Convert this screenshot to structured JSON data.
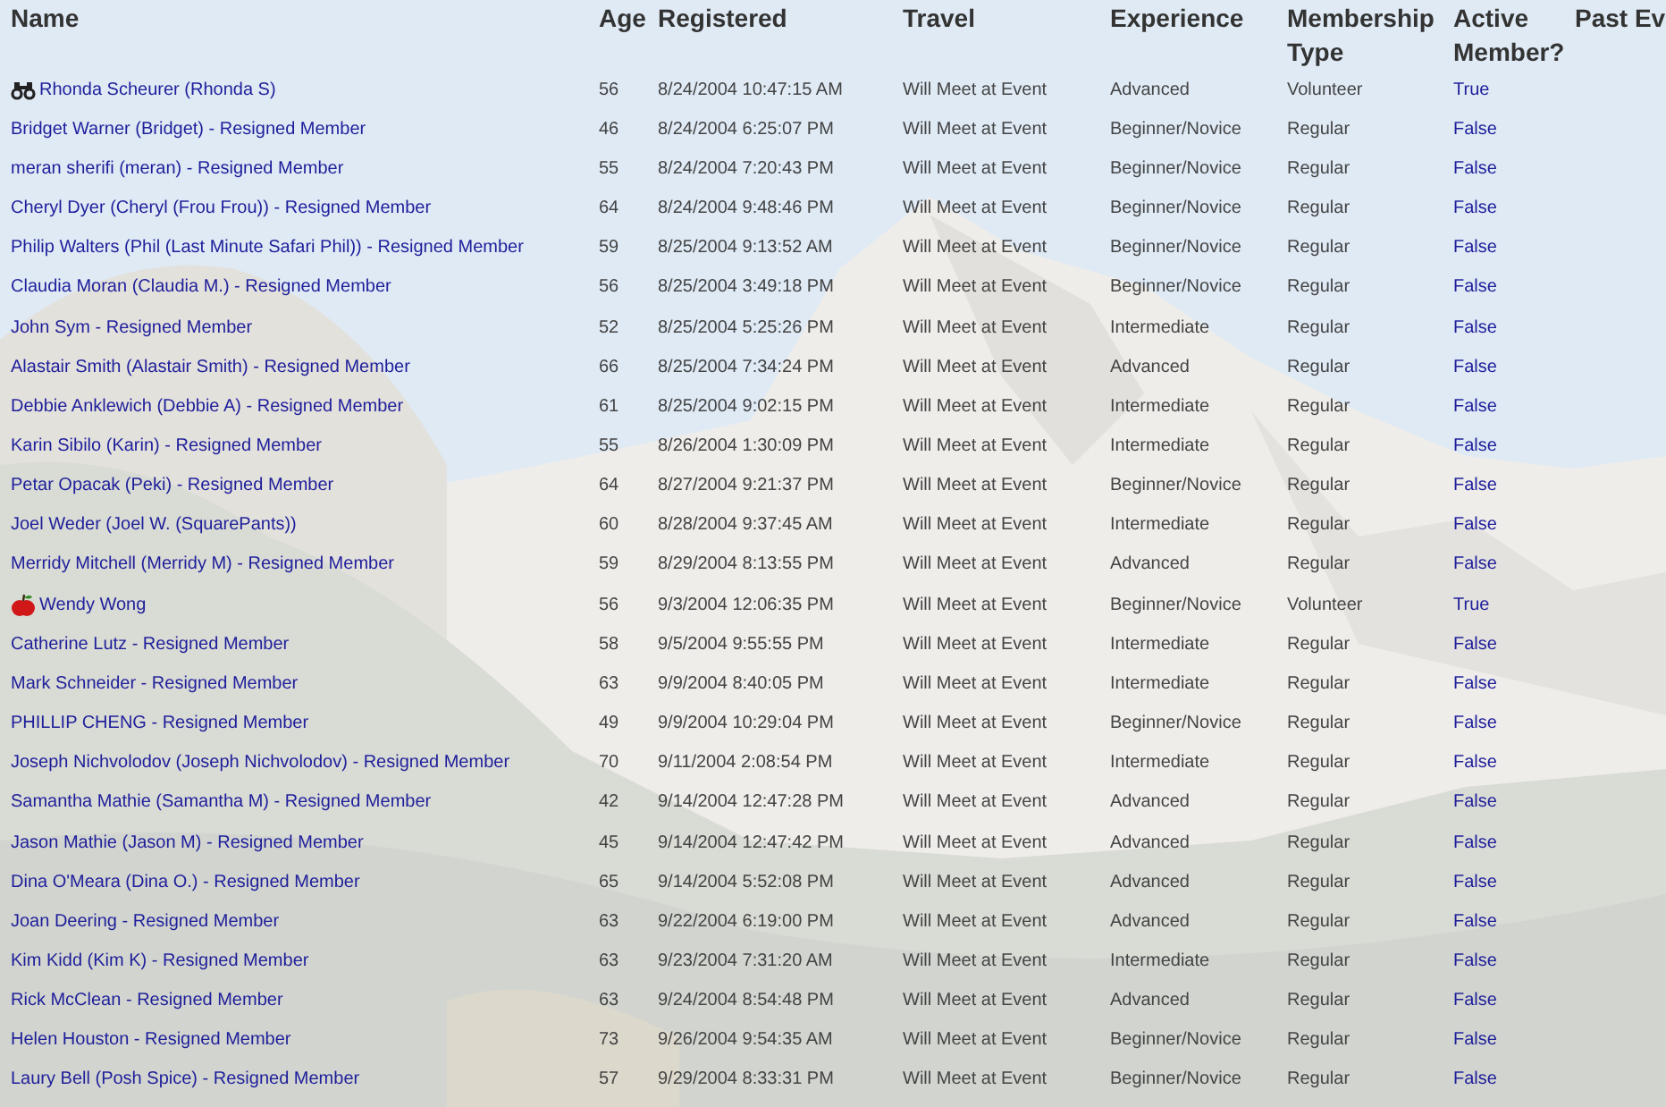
{
  "table": {
    "columns": [
      "Name",
      "Age",
      "Registered",
      "Travel",
      "Experience",
      "Membership Type",
      "Active Member?",
      "Past Ev"
    ],
    "rows": [
      {
        "kind": "binoculars",
        "name": "Rhonda Scheurer (Rhonda S)",
        "age": "56",
        "registered": "8/24/2004 10:47:15 AM",
        "travel": "Will Meet at Event",
        "experience": "Advanced",
        "membership": "Volunteer",
        "active": "True"
      },
      {
        "name": "Bridget Warner (Bridget) - Resigned Member",
        "age": "46",
        "registered": "8/24/2004 6:25:07 PM",
        "travel": "Will Meet at Event",
        "experience": "Beginner/Novice",
        "membership": "Regular",
        "active": "False"
      },
      {
        "name": "meran sherifi (meran) - Resigned Member",
        "age": "55",
        "registered": "8/24/2004 7:20:43 PM",
        "travel": "Will Meet at Event",
        "experience": "Beginner/Novice",
        "membership": "Regular",
        "active": "False"
      },
      {
        "name": "Cheryl Dyer (Cheryl (Frou Frou)) - Resigned Member",
        "age": "64",
        "registered": "8/24/2004 9:48:46 PM",
        "travel": "Will Meet at Event",
        "experience": "Beginner/Novice",
        "membership": "Regular",
        "active": "False"
      },
      {
        "name": "Philip Walters (Phil (Last Minute Safari Phil)) - Resigned Member",
        "age": "59",
        "registered": "8/25/2004 9:13:52 AM",
        "travel": "Will Meet at Event",
        "experience": "Beginner/Novice",
        "membership": "Regular",
        "active": "False"
      },
      {
        "name": "Claudia Moran (Claudia M.) - Resigned Member",
        "age": "56",
        "registered": "8/25/2004 3:49:18 PM",
        "travel": "Will Meet at Event",
        "experience": "Beginner/Novice",
        "membership": "Regular",
        "active": "False"
      },
      {
        "name": "John Sym - Resigned Member",
        "age": "52",
        "registered": "8/25/2004 5:25:26 PM",
        "travel": "Will Meet at Event",
        "experience": "Intermediate",
        "membership": "Regular",
        "active": "False"
      },
      {
        "name": "Alastair Smith (Alastair Smith) - Resigned Member",
        "age": "66",
        "registered": "8/25/2004 7:34:24 PM",
        "travel": "Will Meet at Event",
        "experience": "Advanced",
        "membership": "Regular",
        "active": "False"
      },
      {
        "name": "Debbie Anklewich (Debbie A) - Resigned Member",
        "age": "61",
        "registered": "8/25/2004 9:02:15 PM",
        "travel": "Will Meet at Event",
        "experience": "Intermediate",
        "membership": "Regular",
        "active": "False"
      },
      {
        "name": "Karin Sibilo (Karin) - Resigned Member",
        "age": "55",
        "registered": "8/26/2004 1:30:09 PM",
        "travel": "Will Meet at Event",
        "experience": "Intermediate",
        "membership": "Regular",
        "active": "False"
      },
      {
        "name": "Petar Opacak (Peki) - Resigned Member",
        "age": "64",
        "registered": "8/27/2004 9:21:37 PM",
        "travel": "Will Meet at Event",
        "experience": "Beginner/Novice",
        "membership": "Regular",
        "active": "False"
      },
      {
        "name": "Joel Weder (Joel W. (SquarePants))",
        "age": "60",
        "registered": "8/28/2004 9:37:45 AM",
        "travel": "Will Meet at Event",
        "experience": "Intermediate",
        "membership": "Regular",
        "active": "False"
      },
      {
        "name": "Merridy Mitchell (Merridy M) - Resigned Member",
        "age": "59",
        "registered": "8/29/2004 8:13:55 PM",
        "travel": "Will Meet at Event",
        "experience": "Advanced",
        "membership": "Regular",
        "active": "False"
      },
      {
        "kind": "apple",
        "name": "Wendy Wong",
        "age": "56",
        "registered": "9/3/2004 12:06:35 PM",
        "travel": "Will Meet at Event",
        "experience": "Beginner/Novice",
        "membership": "Volunteer",
        "active": "True"
      },
      {
        "name": "Catherine Lutz - Resigned Member",
        "age": "58",
        "registered": "9/5/2004 9:55:55 PM",
        "travel": "Will Meet at Event",
        "experience": "Intermediate",
        "membership": "Regular",
        "active": "False"
      },
      {
        "name": "Mark Schneider - Resigned Member",
        "age": "63",
        "registered": "9/9/2004 8:40:05 PM",
        "travel": "Will Meet at Event",
        "experience": "Intermediate",
        "membership": "Regular",
        "active": "False"
      },
      {
        "name": "PHILLIP CHENG - Resigned Member",
        "age": "49",
        "registered": "9/9/2004 10:29:04 PM",
        "travel": "Will Meet at Event",
        "experience": "Beginner/Novice",
        "membership": "Regular",
        "active": "False"
      },
      {
        "name": "Joseph Nichvolodov (Joseph Nichvolodov) - Resigned Member",
        "age": "70",
        "registered": "9/11/2004 2:08:54 PM",
        "travel": "Will Meet at Event",
        "experience": "Intermediate",
        "membership": "Regular",
        "active": "False"
      },
      {
        "name": "Samantha Mathie (Samantha M) - Resigned Member",
        "age": "42",
        "registered": "9/14/2004 12:47:28 PM",
        "travel": "Will Meet at Event",
        "experience": "Advanced",
        "membership": "Regular",
        "active": "False"
      },
      {
        "name": "Jason Mathie (Jason M) - Resigned Member",
        "age": "45",
        "registered": "9/14/2004 12:47:42 PM",
        "travel": "Will Meet at Event",
        "experience": "Advanced",
        "membership": "Regular",
        "active": "False"
      },
      {
        "name": "Dina O'Meara (Dina O.) - Resigned Member",
        "age": "65",
        "registered": "9/14/2004 5:52:08 PM",
        "travel": "Will Meet at Event",
        "experience": "Advanced",
        "membership": "Regular",
        "active": "False"
      },
      {
        "name": "Joan Deering - Resigned Member",
        "age": "63",
        "registered": "9/22/2004 6:19:00 PM",
        "travel": "Will Meet at Event",
        "experience": "Advanced",
        "membership": "Regular",
        "active": "False"
      },
      {
        "name": "Kim Kidd (Kim K) - Resigned Member",
        "age": "63",
        "registered": "9/23/2004 7:31:20 AM",
        "travel": "Will Meet at Event",
        "experience": "Intermediate",
        "membership": "Regular",
        "active": "False"
      },
      {
        "name": "Rick McClean - Resigned Member",
        "age": "63",
        "registered": "9/24/2004 8:54:48 PM",
        "travel": "Will Meet at Event",
        "experience": "Advanced",
        "membership": "Regular",
        "active": "False"
      },
      {
        "name": "Helen Houston - Resigned Member",
        "age": "73",
        "registered": "9/26/2004 9:54:35 AM",
        "travel": "Will Meet at Event",
        "experience": "Beginner/Novice",
        "membership": "Regular",
        "active": "False"
      },
      {
        "name": "Laury Bell (Posh Spice) - Resigned Member",
        "age": "57",
        "registered": "9/29/2004 8:33:31 PM",
        "travel": "Will Meet at Event",
        "experience": "Beginner/Novice",
        "membership": "Regular",
        "active": "False"
      }
    ]
  }
}
